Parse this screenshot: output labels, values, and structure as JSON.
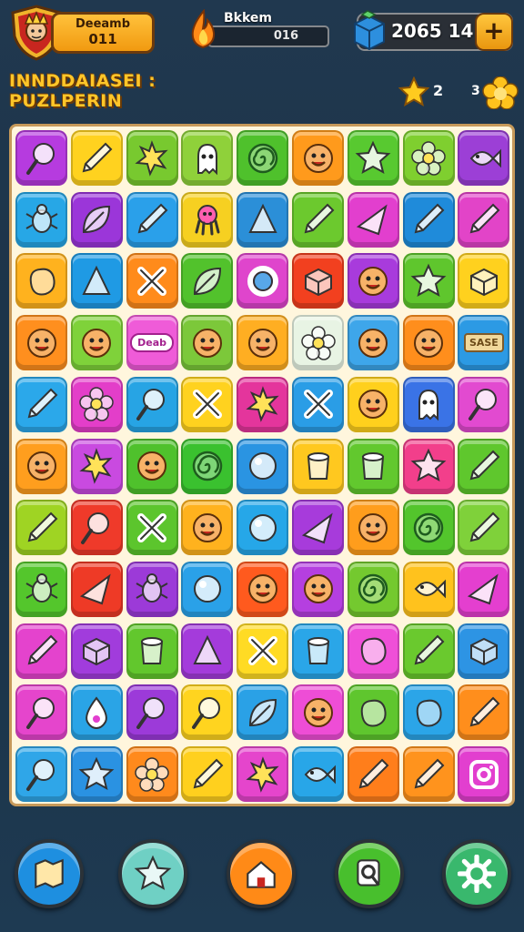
{
  "header": {
    "player_name": "Deeamb",
    "player_level": "011",
    "energy_title": "Bkkem",
    "energy_value": "016",
    "coins": "2065 14",
    "add_label": "+"
  },
  "level": {
    "title_line1": "INNDDAIASEI :",
    "title_line2": "PUZLPERIN",
    "stars": "2",
    "extra": "3"
  },
  "board": {
    "rows": [
      [
        {
          "color": "#b63bdf",
          "icon": "lollipop"
        },
        {
          "color": "#ffd21f",
          "icon": "pencil"
        },
        {
          "color": "#78c92f",
          "icon": "star-burst"
        },
        {
          "color": "#8fd13a",
          "icon": "ghost"
        },
        {
          "color": "#4fc12c",
          "icon": "swirl"
        },
        {
          "color": "#ff9a1c",
          "icon": "face"
        },
        {
          "color": "#58c930",
          "icon": "star"
        },
        {
          "color": "#7fcf2f",
          "icon": "flower"
        },
        {
          "color": "#9c3fd6",
          "icon": "fish"
        }
      ],
      [
        {
          "color": "#27a7e6",
          "icon": "bug"
        },
        {
          "color": "#9b36d9",
          "icon": "leaf"
        },
        {
          "color": "#2aa0ea",
          "icon": "pencil"
        },
        {
          "color": "#f6d021",
          "icon": "octopus"
        },
        {
          "color": "#2b8fd8",
          "icon": "triangle"
        },
        {
          "color": "#6cc92e",
          "icon": "pencil"
        },
        {
          "color": "#e23fce",
          "icon": "cone"
        },
        {
          "color": "#1f8bda",
          "icon": "pencil"
        },
        {
          "color": "#e244c8",
          "icon": "pencil"
        }
      ],
      [
        {
          "color": "#ffb21e",
          "icon": "blob"
        },
        {
          "color": "#1f9ae4",
          "icon": "triangle"
        },
        {
          "color": "#ff8b1b",
          "icon": "cross"
        },
        {
          "color": "#52c22c",
          "icon": "leaf"
        },
        {
          "color": "#df45cc",
          "icon": "ring"
        },
        {
          "color": "#f2401f",
          "icon": "cube"
        },
        {
          "color": "#a83bdc",
          "icon": "face"
        },
        {
          "color": "#5fc62d",
          "icon": "star"
        },
        {
          "color": "#ffd11e",
          "icon": "cube"
        }
      ],
      [
        {
          "color": "#ff8f1e",
          "icon": "face"
        },
        {
          "color": "#7fd23a",
          "icon": "face"
        },
        {
          "color": "#ef5bd8",
          "icon": "badge"
        },
        {
          "color": "#7cc83a",
          "icon": "face"
        },
        {
          "color": "#ffae22",
          "icon": "face"
        },
        {
          "color": "#e8f4e4",
          "icon": "flower"
        },
        {
          "color": "#3ea6ea",
          "icon": "face"
        },
        {
          "color": "#ff8e1c",
          "icon": "face"
        },
        {
          "color": "#2c9ae4",
          "icon": "badge2"
        }
      ],
      [
        {
          "color": "#2ba8ea",
          "icon": "pencil"
        },
        {
          "color": "#e33ec9",
          "icon": "flower"
        },
        {
          "color": "#27a4e4",
          "icon": "lollipop"
        },
        {
          "color": "#ffd21f",
          "icon": "cross"
        },
        {
          "color": "#e4359c",
          "icon": "star-burst"
        },
        {
          "color": "#2a9de6",
          "icon": "cross"
        },
        {
          "color": "#ffd01d",
          "icon": "face"
        },
        {
          "color": "#3a73e6",
          "icon": "ghost"
        },
        {
          "color": "#e24ad0",
          "icon": "lollipop"
        }
      ],
      [
        {
          "color": "#ff9e1e",
          "icon": "face"
        },
        {
          "color": "#c94ae0",
          "icon": "star-burst"
        },
        {
          "color": "#4fc12c",
          "icon": "face"
        },
        {
          "color": "#3ac12f",
          "icon": "swirl"
        },
        {
          "color": "#2a94e2",
          "icon": "ball"
        },
        {
          "color": "#ffc81f",
          "icon": "cup"
        },
        {
          "color": "#62c82e",
          "icon": "cup"
        },
        {
          "color": "#f23f8b",
          "icon": "star"
        },
        {
          "color": "#5fc72d",
          "icon": "pencil"
        }
      ],
      [
        {
          "color": "#9fd423",
          "icon": "pencil"
        },
        {
          "color": "#ef3a2a",
          "icon": "lollipop"
        },
        {
          "color": "#5cc52d",
          "icon": "cross"
        },
        {
          "color": "#ffb21e",
          "icon": "face"
        },
        {
          "color": "#26a7e8",
          "icon": "ball"
        },
        {
          "color": "#a73bdb",
          "icon": "cone"
        },
        {
          "color": "#ff9d1c",
          "icon": "face"
        },
        {
          "color": "#53c52c",
          "icon": "swirl"
        },
        {
          "color": "#7fd13a",
          "icon": "pencil"
        }
      ],
      [
        {
          "color": "#54c62c",
          "icon": "bug"
        },
        {
          "color": "#ee3a26",
          "icon": "cone"
        },
        {
          "color": "#9c3ad8",
          "icon": "bug"
        },
        {
          "color": "#2aa1e8",
          "icon": "ball"
        },
        {
          "color": "#ff5a1e",
          "icon": "face"
        },
        {
          "color": "#b53fe0",
          "icon": "face"
        },
        {
          "color": "#74c92f",
          "icon": "swirl"
        },
        {
          "color": "#ffc21d",
          "icon": "fish"
        },
        {
          "color": "#e43fcf",
          "icon": "cone"
        }
      ],
      [
        {
          "color": "#e443cd",
          "icon": "pencil"
        },
        {
          "color": "#a13cdc",
          "icon": "cube"
        },
        {
          "color": "#62c72d",
          "icon": "cup"
        },
        {
          "color": "#a43bdb",
          "icon": "triangle"
        },
        {
          "color": "#ffdb24",
          "icon": "cross"
        },
        {
          "color": "#2aa6e8",
          "icon": "cup"
        },
        {
          "color": "#ef4fd8",
          "icon": "blob"
        },
        {
          "color": "#6ac92e",
          "icon": "pencil"
        },
        {
          "color": "#2d94e4",
          "icon": "cube"
        }
      ],
      [
        {
          "color": "#e545cc",
          "icon": "lollipop"
        },
        {
          "color": "#2aa4e6",
          "icon": "drop"
        },
        {
          "color": "#9c3ad9",
          "icon": "lollipop"
        },
        {
          "color": "#ffd41f",
          "icon": "lollipop"
        },
        {
          "color": "#2aa1e6",
          "icon": "leaf"
        },
        {
          "color": "#ee4dd6",
          "icon": "face"
        },
        {
          "color": "#5fc62e",
          "icon": "blob"
        },
        {
          "color": "#2ba5e8",
          "icon": "blob"
        },
        {
          "color": "#ff8e1c",
          "icon": "pencil"
        }
      ],
      [
        {
          "color": "#2fa6e8",
          "icon": "lollipop"
        },
        {
          "color": "#2a92e2",
          "icon": "star"
        },
        {
          "color": "#ff8a1c",
          "icon": "flower"
        },
        {
          "color": "#ffd01e",
          "icon": "pencil"
        },
        {
          "color": "#e545cc",
          "icon": "star-burst"
        },
        {
          "color": "#28a6e8",
          "icon": "fish"
        },
        {
          "color": "#ff7e1b",
          "icon": "pencil"
        },
        {
          "color": "#ff931d",
          "icon": "pencil"
        },
        {
          "color": "#e23fcf",
          "icon": "camera"
        }
      ]
    ]
  },
  "nav": [
    {
      "name": "nav-map-button",
      "color": "#1e8fe0",
      "icon": "map"
    },
    {
      "name": "nav-star-button",
      "color": "#6fd0c4",
      "icon": "star"
    },
    {
      "name": "nav-home-button",
      "color": "#ff8a17",
      "icon": "home"
    },
    {
      "name": "nav-search-button",
      "color": "#48bf2d",
      "icon": "search"
    },
    {
      "name": "nav-settings-button",
      "color": "#39b86d",
      "icon": "gear"
    }
  ]
}
